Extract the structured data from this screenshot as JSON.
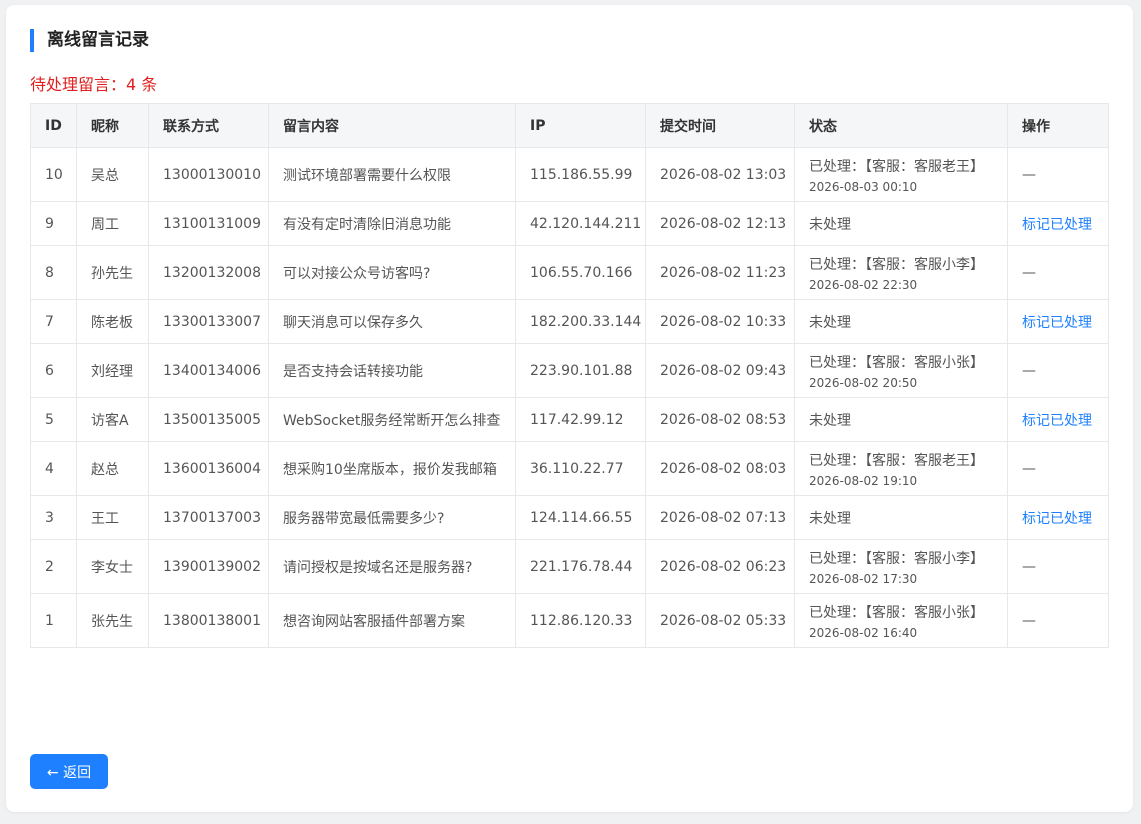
{
  "page": {
    "title": "离线留言记录",
    "pending_text": "待处理留言：4 条"
  },
  "table": {
    "headers": [
      "ID",
      "昵称",
      "联系方式",
      "留言内容",
      "IP",
      "提交时间",
      "状态",
      "操作"
    ],
    "rows": [
      {
        "id": "10",
        "nick": "吴总",
        "contact": "13000130010",
        "content": "测试环境部署需要什么权限",
        "ip": "115.186.55.99",
        "time": "2026-08-02 13:03",
        "status": "已处理：【客服：客服老王】",
        "handled_time": "2026-08-03 00:10",
        "action": "—"
      },
      {
        "id": "9",
        "nick": "周工",
        "contact": "13100131009",
        "content": "有没有定时清除旧消息功能",
        "ip": "42.120.144.211",
        "time": "2026-08-02 12:13",
        "status": "未处理",
        "action": "标记已处理"
      },
      {
        "id": "8",
        "nick": "孙先生",
        "contact": "13200132008",
        "content": "可以对接公众号访客吗?",
        "ip": "106.55.70.166",
        "time": "2026-08-02 11:23",
        "status": "已处理：【客服：客服小李】",
        "handled_time": "2026-08-02 22:30",
        "action": "—"
      },
      {
        "id": "7",
        "nick": "陈老板",
        "contact": "13300133007",
        "content": "聊天消息可以保存多久",
        "ip": "182.200.33.144",
        "time": "2026-08-02 10:33",
        "status": "未处理",
        "action": "标记已处理"
      },
      {
        "id": "6",
        "nick": "刘经理",
        "contact": "13400134006",
        "content": "是否支持会话转接功能",
        "ip": "223.90.101.88",
        "time": "2026-08-02 09:43",
        "status": "已处理：【客服：客服小张】",
        "handled_time": "2026-08-02 20:50",
        "action": "—"
      },
      {
        "id": "5",
        "nick": "访客A",
        "contact": "13500135005",
        "content": "WebSocket服务经常断开怎么排查",
        "ip": "117.42.99.12",
        "time": "2026-08-02 08:53",
        "status": "未处理",
        "action": "标记已处理"
      },
      {
        "id": "4",
        "nick": "赵总",
        "contact": "13600136004",
        "content": "想采购10坐席版本，报价发我邮箱",
        "ip": "36.110.22.77",
        "time": "2026-08-02 08:03",
        "status": "已处理：【客服：客服老王】",
        "handled_time": "2026-08-02 19:10",
        "action": "—"
      },
      {
        "id": "3",
        "nick": "王工",
        "contact": "13700137003",
        "content": "服务器带宽最低需要多少?",
        "ip": "124.114.66.55",
        "time": "2026-08-02 07:13",
        "status": "未处理",
        "action": "标记已处理"
      },
      {
        "id": "2",
        "nick": "李女士",
        "contact": "13900139002",
        "content": "请问授权是按域名还是服务器?",
        "ip": "221.176.78.44",
        "time": "2026-08-02 06:23",
        "status": "已处理：【客服：客服小李】",
        "handled_time": "2026-08-02 17:30",
        "action": "—"
      },
      {
        "id": "1",
        "nick": "张先生",
        "contact": "13800138001",
        "content": "想咨询网站客服插件部署方案",
        "ip": "112.86.120.33",
        "time": "2026-08-02 05:33",
        "status": "已处理：【客服：客服小张】",
        "handled_time": "2026-08-02 16:40",
        "action": "—"
      }
    ]
  },
  "footer": {
    "back_label": "← 返回"
  },
  "colors": {
    "accent": "#1e80ff",
    "pending_red": "#e02020",
    "header_bg": "#f5f6f8"
  }
}
